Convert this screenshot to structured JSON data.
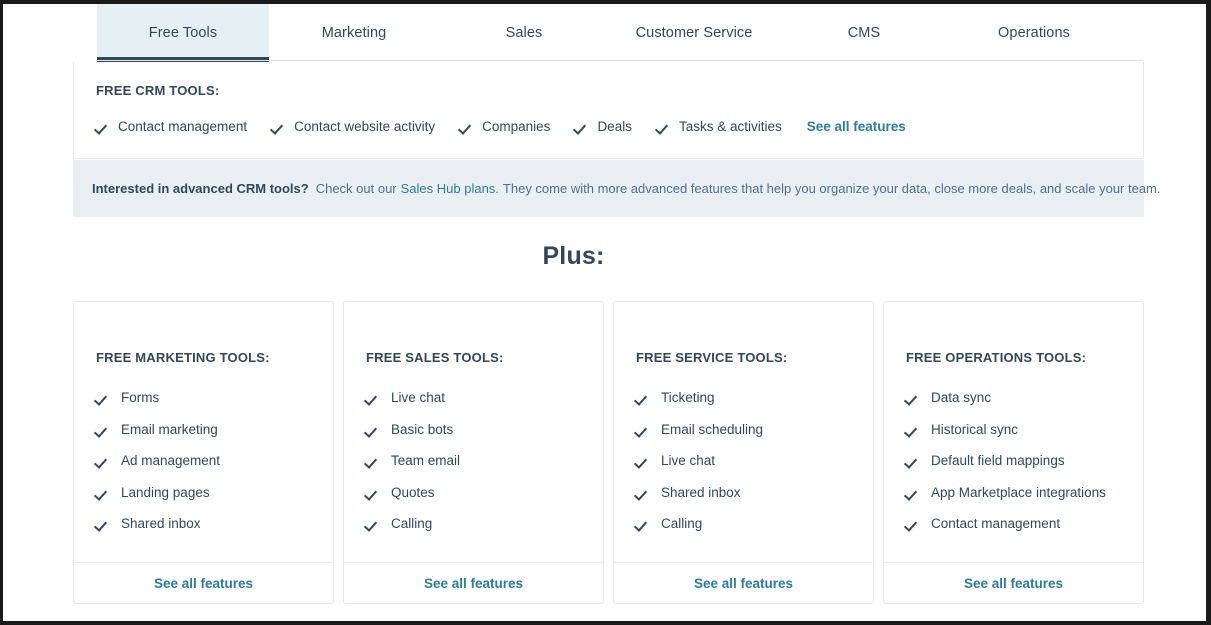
{
  "tabs": [
    {
      "label": "Free Tools",
      "active": true
    },
    {
      "label": "Marketing",
      "active": false
    },
    {
      "label": "Sales",
      "active": false
    },
    {
      "label": "Customer Service",
      "active": false
    },
    {
      "label": "CMS",
      "active": false
    },
    {
      "label": "Operations",
      "active": false
    }
  ],
  "crm_section": {
    "title": "FREE CRM TOOLS:",
    "features": [
      "Contact management",
      "Contact website activity",
      "Companies",
      "Deals",
      "Tasks & activities"
    ],
    "see_all_label": "See all features"
  },
  "cta_banner": {
    "strong": "Interested in advanced CRM tools?",
    "text_before": "Check out our",
    "link": "Sales Hub plans.",
    "text_after": "They come with more advanced features that help you organize your data, close more deals, and scale your team."
  },
  "plus_heading": "Plus:",
  "cards": [
    {
      "title": "FREE MARKETING TOOLS:",
      "features": [
        "Forms",
        "Email marketing",
        "Ad management",
        "Landing pages",
        "Shared inbox"
      ],
      "see_all_label": "See all features"
    },
    {
      "title": "FREE SALES TOOLS:",
      "features": [
        "Live chat",
        "Basic bots",
        "Team email",
        "Quotes",
        "Calling"
      ],
      "see_all_label": "See all features"
    },
    {
      "title": "FREE SERVICE TOOLS:",
      "features": [
        "Ticketing",
        "Email scheduling",
        "Live chat",
        "Shared inbox",
        "Calling"
      ],
      "see_all_label": "See all features"
    },
    {
      "title": "FREE OPERATIONS TOOLS:",
      "features": [
        "Data sync",
        "Historical sync",
        "Default field mappings",
        "App Marketplace integrations",
        "Contact management"
      ],
      "see_all_label": "See all features"
    }
  ],
  "colors": {
    "text_primary": "#33475b",
    "link": "#2e7b9e",
    "active_tab_bg": "#e5f0f5",
    "active_tab_underline": "#33475b",
    "banner_bg": "#eaeff3",
    "card_border": "#e5e9ef"
  }
}
